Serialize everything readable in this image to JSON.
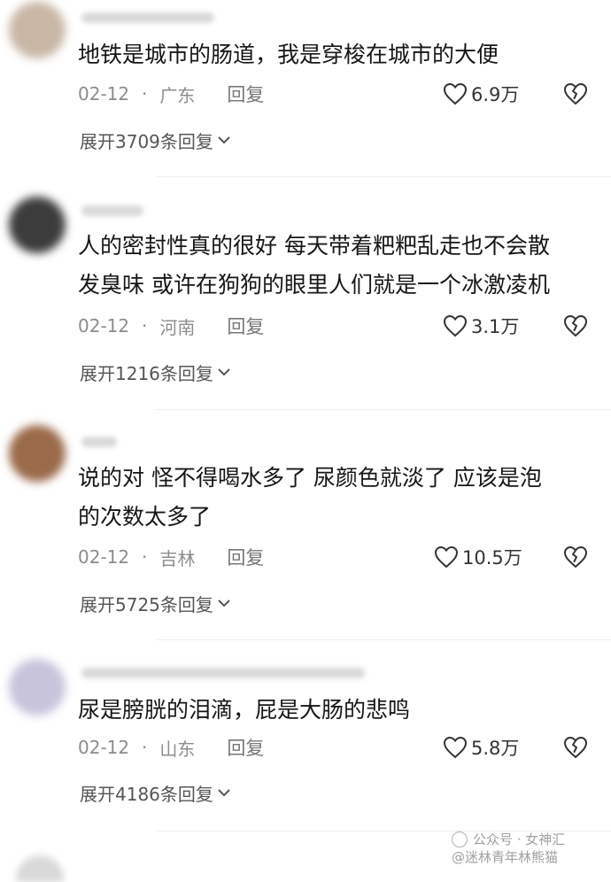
{
  "reply_label": "回复",
  "comments": [
    {
      "text": "地铁是城市的肠道，我是穿梭在城市的大便",
      "date": "02-12",
      "separator": "·",
      "region": "广东",
      "likes": "6.9万",
      "expand_label": "展开3709条回复",
      "avatar_color": "#c9b7a6"
    },
    {
      "text": "人的密封性真的很好 每天带着粑粑乱走也不会散\n发臭味 或许在狗狗的眼里人们就是一个冰激凌机",
      "date": "02-12",
      "separator": "·",
      "region": "河南",
      "likes": "3.1万",
      "expand_label": "展开1216条回复",
      "avatar_color": "#3c3c3c"
    },
    {
      "text": "说的对 怪不得喝水多了 尿颜色就淡了 应该是泡\n的次数太多了",
      "date": "02-12",
      "separator": "·",
      "region": "吉林",
      "likes": "10.5万",
      "expand_label": "展开5725条回复",
      "avatar_color": "#9a6a4a"
    },
    {
      "text": "尿是膀胱的泪滴，屁是大肠的悲鸣",
      "date": "02-12",
      "separator": "·",
      "region": "山东",
      "likes": "5.8万",
      "expand_label": "展开4186条回复",
      "avatar_color": "#c8c4dc"
    }
  ],
  "watermark": {
    "line1": "公众号 · 女神汇",
    "line2": "@迷林青年林熊猫"
  },
  "colors": {
    "text": "#161616",
    "meta": "#8c8c8c",
    "divider": "#efefef"
  }
}
